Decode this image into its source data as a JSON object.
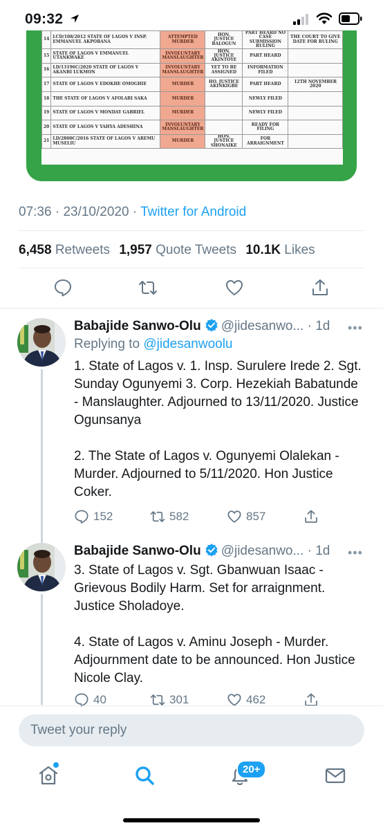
{
  "status_bar": {
    "time": "09:32"
  },
  "media": {
    "rows": [
      {
        "n": "14",
        "case": "LCD/108/2012 STATE OF LAGOS   V   INSP. EMMANUEL AKPOBANA",
        "offence": "ATTEMPTED MURDER",
        "judge": "HON. JUSTICE BALOGUN",
        "status": "PART HEARD NO CASE SUBMISSION RULING",
        "note": "THE COURT TO GIVE DATE FOR RULING"
      },
      {
        "n": "15",
        "case": "STATE OF LAGOS   V   EMMANUEL UTANKWAKE",
        "offence": "INVOLUNTARY MANSLAUGHTER",
        "judge": "HON. JUSTICE AKINTOYE",
        "status": "PART HEARD",
        "note": ""
      },
      {
        "n": "16",
        "case": "LD/13196C/2020 STATE OF LAGOS   V   AKANBI LUKMON",
        "offence": "INVOLUNTARY MANSLAUGHTER",
        "judge": "YET TO BE ASSIGNED",
        "status": "INFORMATION FILED",
        "note": ""
      },
      {
        "n": "17",
        "case": "STATE OF LAGOS   V   EDOKHE OMOGHIE",
        "offence": "MURDER",
        "judge": "HO. JUSTICE AKINKIGBE",
        "status": "PART HEARD",
        "note": "12TH NOVEMBER 2020"
      },
      {
        "n": "18",
        "case": "THE STATE OF LAGOS   V   AFOLABI SAKA",
        "offence": "MURDER",
        "judge": "",
        "status": "NEWLY FILED",
        "note": ""
      },
      {
        "n": "19",
        "case": "STATE OF LAGOS   V   MONDAY GABRIEL",
        "offence": "MURDER",
        "judge": "",
        "status": "NEWLY FILED",
        "note": ""
      },
      {
        "n": "20",
        "case": "STATE OF LAGOS   V   YAHYA ADESHINA",
        "offence": "INVOLUNTARY MANSLAUGHTER",
        "judge": "",
        "status": "READY FOR FILING",
        "note": ""
      },
      {
        "n": "21",
        "case": "LD/2800C/2016 STATE OF LAGOS   V   AREMU MUSELIU",
        "offence": "MURDER",
        "judge": "HON. JUSTICE SHONAIKE",
        "status": "FOR ARRAIGNMENT",
        "note": ""
      }
    ]
  },
  "tweet_meta": {
    "time": "07:36",
    "date": "23/10/2020",
    "source": "Twitter for Android"
  },
  "stats": {
    "retweets_count": "6,458",
    "retweets_label": "Retweets",
    "quotes_count": "1,957",
    "quotes_label": "Quote Tweets",
    "likes_count": "10.1K",
    "likes_label": "Likes"
  },
  "replies": [
    {
      "name": "Babajide Sanwo-Olu",
      "handle": "@jidesanwo...",
      "age": "1d",
      "replying_prefix": "Replying to",
      "replying_handle": "@jidesanwoolu",
      "paragraphs": [
        "1. State of Lagos v. 1. Insp. Surulere Irede 2. Sgt. Sunday Ogunyemi 3. Corp. Hezekiah Babatunde - Manslaughter. Adjourned to 13/11/2020. Justice Ogunsanya",
        "2. The State of Lagos v. Ogunyemi Olalekan - Murder. Adjourned to 5/11/2020. Hon Justice Coker."
      ],
      "reply_count": "152",
      "retweet_count": "582",
      "like_count": "857"
    },
    {
      "name": "Babajide Sanwo-Olu",
      "handle": "@jidesanwo...",
      "age": "1d",
      "paragraphs": [
        "3. State of Lagos v. Sgt. Gbanwuan Isaac - Grievous Bodily Harm. Set for arraignment. Justice Sholadoye.",
        "4. State of Lagos v. Aminu Joseph - Murder. Adjournment date to be announced. Hon Justice Nicole Clay."
      ],
      "reply_count": "40",
      "retweet_count": "301",
      "like_count": "462"
    }
  ],
  "composer": {
    "placeholder": "Tweet your reply"
  },
  "tabbar": {
    "notifications_badge": "20+"
  },
  "colors": {
    "accent": "#1da1f2",
    "media_border": "#35a347",
    "offence_cell": "#f0a890"
  }
}
